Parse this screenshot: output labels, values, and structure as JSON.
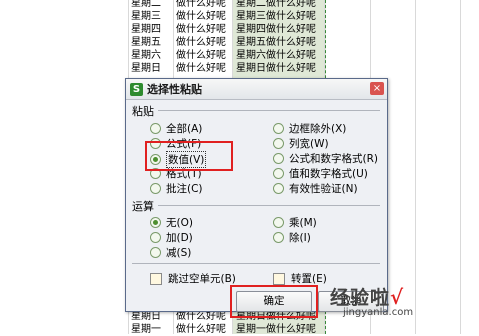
{
  "sheet_rows_top": [
    {
      "day": "星期二",
      "q": "做什么好呢",
      "c": "星期二做什么好呢"
    },
    {
      "day": "星期三",
      "q": "做什么好呢",
      "c": "星期三做什么好呢"
    },
    {
      "day": "星期四",
      "q": "做什么好呢",
      "c": "星期四做什么好呢"
    },
    {
      "day": "星期五",
      "q": "做什么好呢",
      "c": "星期五做什么好呢"
    },
    {
      "day": "星期六",
      "q": "做什么好呢",
      "c": "星期六做什么好呢"
    },
    {
      "day": "星期日",
      "q": "做什么好呢",
      "c": "星期日做什么好呢"
    }
  ],
  "sheet_rows_bottom": [
    {
      "day": "星期日",
      "q": "做什么好呢",
      "c": "星期日做什么好呢"
    },
    {
      "day": "星期一",
      "q": "做什么好呢",
      "c": "星期一做什么好呢"
    }
  ],
  "dialog": {
    "icon": "S",
    "title": "选择性粘贴",
    "close": "×",
    "paste_label": "粘贴",
    "paste_left": [
      "全部(A)",
      "公式(F)",
      "数值(V)",
      "格式(T)",
      "批注(C)"
    ],
    "paste_right": [
      "边框除外(X)",
      "列宽(W)",
      "公式和数字格式(R)",
      "值和数字格式(U)",
      "有效性验证(N)"
    ],
    "op_label": "运算",
    "op_left": [
      "无(O)",
      "加(D)",
      "减(S)"
    ],
    "op_right": [
      "乘(M)",
      "除(I)"
    ],
    "skip_blanks": "跳过空单元(B)",
    "transpose": "转置(E)",
    "ok": "确定",
    "cancel": "取消"
  },
  "watermark": {
    "text": "经验啦",
    "check": "√",
    "url": "jingyanla.com"
  }
}
